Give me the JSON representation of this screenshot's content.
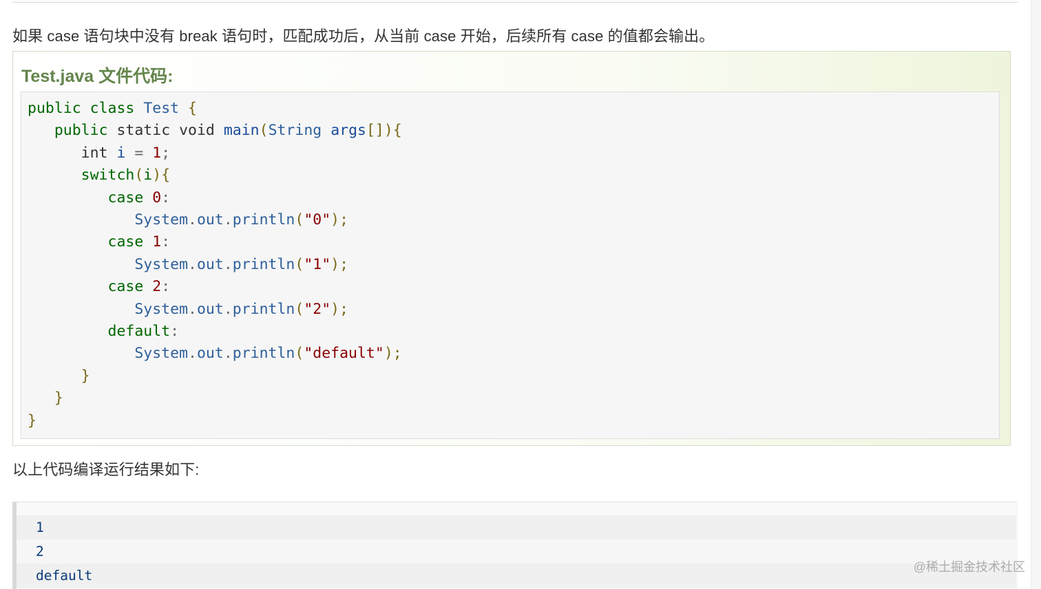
{
  "intro_text": "如果 case 语句块中没有 break 语句时，匹配成功后，从当前 case 开始，后续所有 case 的值都会输出。",
  "example": {
    "title": "Test.java 文件代码:",
    "code": {
      "l1_public": "public",
      "l1_class": "class",
      "l1_name": "Test",
      "l1_brace": "{",
      "l2_public": "public",
      "l2_static": "static",
      "l2_void": "void",
      "l2_main": "main",
      "l2_paren": "(",
      "l2_type": "String",
      "l2_args": "args",
      "l2_tail": "[]){",
      "l3_int": "int",
      "l3_var": "i",
      "l3_eq": "=",
      "l3_num": "1",
      "l3_semi": ";",
      "l4_switch": "switch",
      "l4_open": "(",
      "l4_var": "i",
      "l4_close": "){",
      "case0": "case",
      "case0_num": "0",
      "case0_colon": ":",
      "p0_sys": "System",
      "p0_dot1": ".",
      "p0_out": "out",
      "p0_dot2": ".",
      "p0_fn": "println",
      "p0_open": "(",
      "p0_str": "\"0\"",
      "p0_end": ");",
      "case1": "case",
      "case1_num": "1",
      "case1_colon": ":",
      "p1_sys": "System",
      "p1_dot1": ".",
      "p1_out": "out",
      "p1_dot2": ".",
      "p1_fn": "println",
      "p1_open": "(",
      "p1_str": "\"1\"",
      "p1_end": ");",
      "case2": "case",
      "case2_num": "2",
      "case2_colon": ":",
      "p2_sys": "System",
      "p2_dot1": ".",
      "p2_out": "out",
      "p2_dot2": ".",
      "p2_fn": "println",
      "p2_open": "(",
      "p2_str": "\"2\"",
      "p2_end": ");",
      "default_kw": "default",
      "default_colon": ":",
      "pd_sys": "System",
      "pd_dot1": ".",
      "pd_out": "out",
      "pd_dot2": ".",
      "pd_fn": "println",
      "pd_open": "(",
      "pd_str": "\"default\"",
      "pd_end": ");",
      "close_switch": "}",
      "close_main": "}",
      "close_class": "}"
    }
  },
  "result_intro": "以上代码编译运行结果如下:",
  "output_lines": [
    "1",
    "2",
    "default"
  ],
  "watermark": "@稀土掘金技术社区",
  "colors": {
    "keyword": "#006600",
    "type": "#2e5f9a",
    "number": "#880000",
    "string": "#880000",
    "title": "#64854c",
    "output_text": "#0a3b78"
  }
}
